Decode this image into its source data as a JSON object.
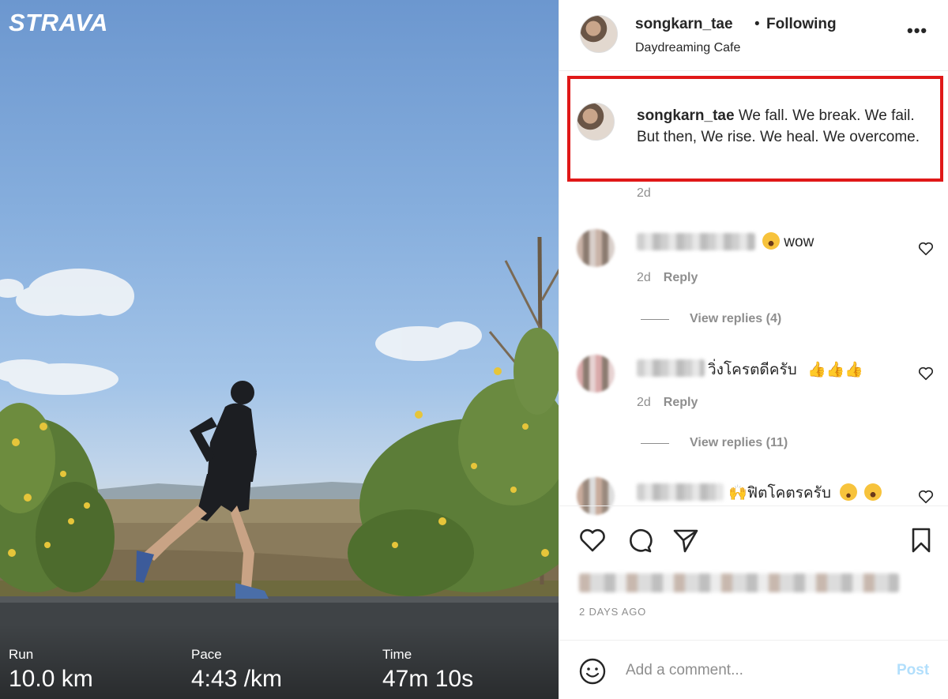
{
  "strava": {
    "logo": "STRAVA",
    "stats": [
      {
        "label": "Run",
        "value": "10.0 km"
      },
      {
        "label": "Pace",
        "value": "4:43 /km"
      },
      {
        "label": "Time",
        "value": "47m 10s"
      }
    ]
  },
  "post": {
    "header": {
      "username": "songkarn_tae",
      "separator": "•",
      "follow_status": "Following",
      "location": "Daydreaming Cafe",
      "more_icon": "more-icon"
    },
    "caption": {
      "username": "songkarn_tae",
      "text": "We fall. We break. We fail. But then, We rise. We heal. We overcome.",
      "time": "2d"
    },
    "comments": [
      {
        "text": "wow",
        "emoji_before": "😮",
        "time": "2d",
        "reply_label": "Reply",
        "view_replies": "View replies (4)"
      },
      {
        "text": "วิ่งโครตดีครับ",
        "emoji_after": "👍🏻👍🏻👍🏻",
        "time": "2d",
        "reply_label": "Reply",
        "view_replies": "View replies (11)"
      },
      {
        "text": "ฟิตโคตรครับ",
        "emoji_before": "🙌",
        "emoji_after": "😅😮"
      }
    ],
    "actions": {
      "icons": [
        "heart-icon",
        "comment-icon",
        "share-icon",
        "bookmark-icon"
      ],
      "posted_ago": "2 DAYS AGO"
    },
    "add_comment": {
      "placeholder": "Add a comment...",
      "post_label": "Post"
    }
  }
}
